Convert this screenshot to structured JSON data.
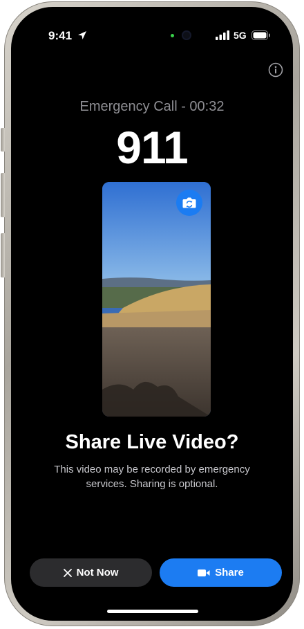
{
  "status_bar": {
    "time": "9:41",
    "network": "5G",
    "location_icon": "location-arrow-icon",
    "signal_icon": "cellular-signal-icon",
    "battery_icon": "battery-icon"
  },
  "header": {
    "info_icon": "info-icon"
  },
  "call": {
    "status": "Emergency Call - 00:32",
    "number": "911"
  },
  "video_preview": {
    "flip_camera_icon": "flip-camera-icon"
  },
  "prompt": {
    "title": "Share Live Video?",
    "body": "This video may be recorded by emergency services. Sharing is optional."
  },
  "actions": {
    "not_now_label": "Not Now",
    "not_now_icon": "close-x-icon",
    "share_label": "Share",
    "share_icon": "video-camera-icon"
  },
  "colors": {
    "background": "#000000",
    "accent": "#1c7cf2",
    "secondary_button": "#2c2c2e",
    "muted_text": "#8e8e93",
    "camera_indicator": "#38d14a"
  }
}
